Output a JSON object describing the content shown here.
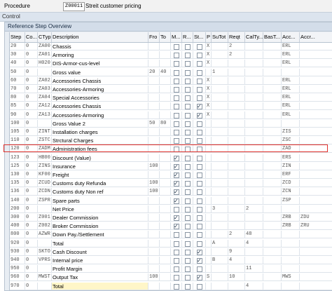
{
  "procedure": {
    "label": "Procedure",
    "code": "Z00011",
    "description": "Streit customer pricing"
  },
  "control_label": "Control",
  "panel_title": "Reference Step Overview",
  "columns": [
    "Step",
    "Co...",
    "CTyp",
    "Description",
    "Fro",
    "To",
    "M...",
    "R...",
    "St...",
    "P",
    "SuTot",
    "Reqt",
    "CalTy...",
    "BasT...",
    "Acc...",
    "Accr..."
  ],
  "rows": [
    {
      "step": "20",
      "cntr": "0",
      "ctyp": "ZA00",
      "desc": "Chassis",
      "from": "",
      "to": "",
      "man": false,
      "req": false,
      "stat": false,
      "p": "X",
      "subt": "",
      "reqt": "2",
      "alt": "",
      "basty": "",
      "acc": "ERL",
      "accr": ""
    },
    {
      "step": "30",
      "cntr": "0",
      "ctyp": "ZA01",
      "desc": "Armoring",
      "from": "",
      "to": "",
      "man": false,
      "req": false,
      "stat": false,
      "p": "X",
      "subt": "",
      "reqt": "2",
      "alt": "",
      "basty": "",
      "acc": "ERL",
      "accr": ""
    },
    {
      "step": "40",
      "cntr": "0",
      "ctyp": "H020",
      "desc": "DIS-Armor-cus-level",
      "from": "",
      "to": "",
      "man": false,
      "req": false,
      "stat": false,
      "p": "X",
      "subt": "",
      "reqt": "",
      "alt": "",
      "basty": "",
      "acc": "ERL",
      "accr": ""
    },
    {
      "step": "50",
      "cntr": "0",
      "ctyp": "",
      "desc": "Gross value",
      "from": "20",
      "to": "40",
      "man": false,
      "req": false,
      "stat": false,
      "p": "",
      "subt": "1",
      "reqt": "",
      "alt": "",
      "basty": "",
      "acc": "",
      "accr": ""
    },
    {
      "step": "60",
      "cntr": "0",
      "ctyp": "ZA02",
      "desc": "Accessories Chassis",
      "from": "",
      "to": "",
      "man": false,
      "req": false,
      "stat": false,
      "p": "X",
      "subt": "",
      "reqt": "",
      "alt": "",
      "basty": "",
      "acc": "ERL",
      "accr": ""
    },
    {
      "step": "70",
      "cntr": "0",
      "ctyp": "ZA03",
      "desc": "Accessories-Armoring",
      "from": "",
      "to": "",
      "man": false,
      "req": false,
      "stat": false,
      "p": "X",
      "subt": "",
      "reqt": "",
      "alt": "",
      "basty": "",
      "acc": "ERL",
      "accr": ""
    },
    {
      "step": "80",
      "cntr": "0",
      "ctyp": "ZA04",
      "desc": "Special Accessories",
      "from": "",
      "to": "",
      "man": false,
      "req": false,
      "stat": false,
      "p": "X",
      "subt": "",
      "reqt": "",
      "alt": "",
      "basty": "",
      "acc": "ERL",
      "accr": ""
    },
    {
      "step": "85",
      "cntr": "0",
      "ctyp": "ZA12",
      "desc": "Accessories Chassis",
      "from": "",
      "to": "",
      "man": false,
      "req": false,
      "stat": true,
      "p": "X",
      "subt": "",
      "reqt": "",
      "alt": "",
      "basty": "",
      "acc": "ERL",
      "accr": ""
    },
    {
      "step": "90",
      "cntr": "0",
      "ctyp": "ZA13",
      "desc": "Accessories-Armoring",
      "from": "",
      "to": "",
      "man": false,
      "req": false,
      "stat": true,
      "p": "X",
      "subt": "",
      "reqt": "",
      "alt": "",
      "basty": "",
      "acc": "ERL",
      "accr": ""
    },
    {
      "step": "100",
      "cntr": "0",
      "ctyp": "",
      "desc": "Gross Value 2",
      "from": "50",
      "to": "80",
      "man": false,
      "req": false,
      "stat": false,
      "p": "",
      "subt": "",
      "reqt": "",
      "alt": "",
      "basty": "",
      "acc": "",
      "accr": ""
    },
    {
      "step": "105",
      "cntr": "0",
      "ctyp": "ZINT",
      "desc": "Installation charges",
      "from": "",
      "to": "",
      "man": false,
      "req": false,
      "stat": false,
      "p": "",
      "subt": "",
      "reqt": "",
      "alt": "",
      "basty": "",
      "acc": "ZIS",
      "accr": ""
    },
    {
      "step": "110",
      "cntr": "0",
      "ctyp": "ZSTC",
      "desc": "Strctural Charges",
      "from": "",
      "to": "",
      "man": false,
      "req": false,
      "stat": false,
      "p": "",
      "subt": "",
      "reqt": "",
      "alt": "",
      "basty": "",
      "acc": "ZSC",
      "accr": ""
    },
    {
      "step": "120",
      "cntr": "0",
      "ctyp": "ZADM",
      "desc": "Administration fees",
      "from": "",
      "to": "",
      "man": false,
      "req": false,
      "stat": false,
      "p": "",
      "subt": "",
      "reqt": "",
      "alt": "",
      "basty": "",
      "acc": "ZAD",
      "accr": ""
    },
    {
      "step": "123",
      "cntr": "0",
      "ctyp": "HB00",
      "desc": "Discount (Value)",
      "from": "",
      "to": "",
      "man": true,
      "req": false,
      "stat": false,
      "p": "",
      "subt": "",
      "reqt": "",
      "alt": "",
      "basty": "",
      "acc": "ERS",
      "accr": ""
    },
    {
      "step": "125",
      "cntr": "0",
      "ctyp": "ZINS",
      "desc": "Insurance",
      "from": "100",
      "to": "",
      "man": true,
      "req": false,
      "stat": false,
      "p": "",
      "subt": "",
      "reqt": "",
      "alt": "",
      "basty": "",
      "acc": "ZIN",
      "accr": ""
    },
    {
      "step": "130",
      "cntr": "0",
      "ctyp": "KF00",
      "desc": "Freight",
      "from": "",
      "to": "",
      "man": true,
      "req": false,
      "stat": false,
      "p": "",
      "subt": "",
      "reqt": "",
      "alt": "",
      "basty": "",
      "acc": "ERF",
      "accr": ""
    },
    {
      "step": "135",
      "cntr": "0",
      "ctyp": "ZCUD",
      "desc": "Customs duty Refunda",
      "from": "100",
      "to": "",
      "man": true,
      "req": false,
      "stat": false,
      "p": "",
      "subt": "",
      "reqt": "",
      "alt": "",
      "basty": "",
      "acc": "ZCD",
      "accr": ""
    },
    {
      "step": "136",
      "cntr": "0",
      "ctyp": "ZCDN",
      "desc": "Customs duty Non ref",
      "from": "100",
      "to": "",
      "man": true,
      "req": false,
      "stat": false,
      "p": "",
      "subt": "",
      "reqt": "",
      "alt": "",
      "basty": "",
      "acc": "ZCN",
      "accr": ""
    },
    {
      "step": "140",
      "cntr": "0",
      "ctyp": "ZSPR",
      "desc": "Spare parts",
      "from": "",
      "to": "",
      "man": true,
      "req": false,
      "stat": false,
      "p": "",
      "subt": "",
      "reqt": "",
      "alt": "",
      "basty": "",
      "acc": "ZSP",
      "accr": ""
    },
    {
      "step": "200",
      "cntr": "0",
      "ctyp": "",
      "desc": "Net Price",
      "from": "",
      "to": "",
      "man": false,
      "req": false,
      "stat": false,
      "p": "",
      "subt": "3",
      "reqt": "",
      "alt": "2",
      "basty": "",
      "acc": "",
      "accr": ""
    },
    {
      "step": "300",
      "cntr": "0",
      "ctyp": "Z001",
      "desc": "Dealer Commission",
      "from": "",
      "to": "",
      "man": true,
      "req": false,
      "stat": false,
      "p": "",
      "subt": "",
      "reqt": "",
      "alt": "",
      "basty": "",
      "acc": "ZRB",
      "accr": "ZDU"
    },
    {
      "step": "400",
      "cntr": "0",
      "ctyp": "Z002",
      "desc": "Broker Commission",
      "from": "",
      "to": "",
      "man": true,
      "req": false,
      "stat": false,
      "p": "",
      "subt": "",
      "reqt": "",
      "alt": "",
      "basty": "",
      "acc": "ZRB",
      "accr": "ZRU"
    },
    {
      "step": "800",
      "cntr": "0",
      "ctyp": "AZWR",
      "desc": "Down Pay./Settlement",
      "from": "",
      "to": "",
      "man": false,
      "req": false,
      "stat": false,
      "p": "",
      "subt": "",
      "reqt": "2",
      "alt": "48",
      "basty": "",
      "acc": "",
      "accr": ""
    },
    {
      "step": "920",
      "cntr": "0",
      "ctyp": "",
      "desc": "Total",
      "from": "",
      "to": "",
      "man": false,
      "req": false,
      "stat": false,
      "p": "",
      "subt": "A",
      "reqt": "",
      "alt": "4",
      "basty": "",
      "acc": "",
      "accr": ""
    },
    {
      "step": "930",
      "cntr": "0",
      "ctyp": "SKTO",
      "desc": "Cash Discount",
      "from": "",
      "to": "",
      "man": false,
      "req": false,
      "stat": true,
      "p": "",
      "subt": "",
      "reqt": "9",
      "alt": "",
      "basty": "",
      "acc": "",
      "accr": ""
    },
    {
      "step": "940",
      "cntr": "0",
      "ctyp": "VPRS",
      "desc": "Internal price",
      "from": "",
      "to": "",
      "man": false,
      "req": false,
      "stat": true,
      "p": "",
      "subt": "B",
      "reqt": "4",
      "alt": "",
      "basty": "",
      "acc": "",
      "accr": ""
    },
    {
      "step": "950",
      "cntr": "0",
      "ctyp": "",
      "desc": "Profit Margin",
      "from": "",
      "to": "",
      "man": false,
      "req": false,
      "stat": false,
      "p": "",
      "subt": "",
      "reqt": "",
      "alt": "11",
      "basty": "",
      "acc": "",
      "accr": ""
    },
    {
      "step": "960",
      "cntr": "0",
      "ctyp": "MWST",
      "desc": "Output Tax",
      "from": "100",
      "to": "",
      "man": false,
      "req": false,
      "stat": true,
      "p": "S",
      "subt": "",
      "reqt": "10",
      "alt": "",
      "basty": "",
      "acc": "MWS",
      "accr": ""
    },
    {
      "step": "970",
      "cntr": "0",
      "ctyp": "",
      "desc": "Total",
      "from": "",
      "to": "",
      "man": false,
      "req": false,
      "stat": false,
      "p": "",
      "subt": "",
      "reqt": "",
      "alt": "4",
      "basty": "",
      "acc": "",
      "accr": ""
    }
  ],
  "highlighted_step": "120",
  "colors": {
    "highlight": "#e0302b",
    "header": "#f2f4f7",
    "panel": "#e8edf3"
  }
}
